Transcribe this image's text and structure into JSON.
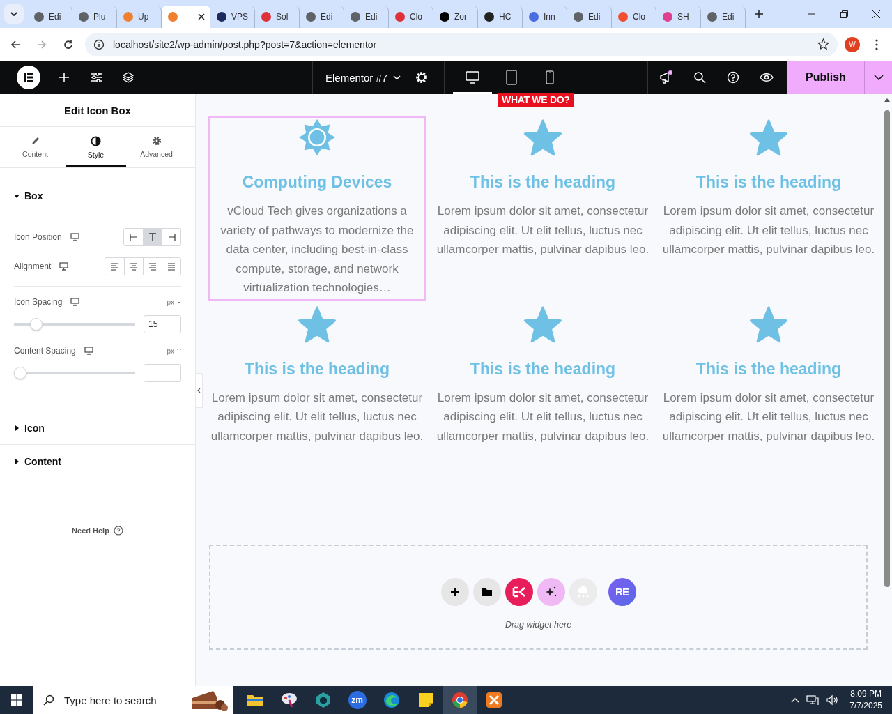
{
  "browser": {
    "tabs": [
      {
        "label": "Edi",
        "selected": false,
        "color": "#5f6368"
      },
      {
        "label": "Plu",
        "selected": false,
        "color": "#5f6368"
      },
      {
        "label": "Up",
        "selected": false,
        "color": "#f08030"
      },
      {
        "selected": true,
        "color": "#f08030"
      },
      {
        "label": "VPS",
        "selected": false,
        "color": "#1a2a5e"
      },
      {
        "label": "Sol",
        "selected": false,
        "color": "#e0303a"
      },
      {
        "label": "Edi",
        "selected": false,
        "color": "#5f6368"
      },
      {
        "label": "Edi",
        "selected": false,
        "color": "#5f6368"
      },
      {
        "label": "Clo",
        "selected": false,
        "color": "#e0303a"
      },
      {
        "label": "Zor",
        "selected": false,
        "color": "#000000"
      },
      {
        "label": "HC",
        "selected": false,
        "color": "#222222"
      },
      {
        "label": "Inn",
        "selected": false,
        "color": "#4a6ee0"
      },
      {
        "label": "Edi",
        "selected": false,
        "color": "#5f6368"
      },
      {
        "label": "Clo",
        "selected": false,
        "color": "#f05030"
      },
      {
        "label": "SH",
        "selected": false,
        "color": "#e04090"
      },
      {
        "label": "Edi",
        "selected": false,
        "color": "#5f6368"
      }
    ],
    "url": "localhost/site2/wp-admin/post.php?post=7&action=elementor",
    "profile": "W"
  },
  "editor_bar": {
    "document_title": "Elementor #7",
    "devices": [
      {
        "kind": "desktop",
        "selected": true
      },
      {
        "kind": "tablet",
        "selected": false
      },
      {
        "kind": "mobile",
        "selected": false
      }
    ],
    "publish": "Publish"
  },
  "panel": {
    "title": "Edit Icon Box",
    "tabs": [
      {
        "label": "Content",
        "kind": "pencil",
        "selected": false
      },
      {
        "label": "Style",
        "kind": "contrast",
        "selected": true
      },
      {
        "label": "Advanced",
        "kind": "gear",
        "selected": false
      }
    ],
    "sections": [
      {
        "label": "Box",
        "expanded": true,
        "controls": [
          {
            "kind": "choice",
            "label": "Icon Position",
            "options": [
              {
                "kind": "left",
                "selected": false
              },
              {
                "kind": "top",
                "selected": true
              },
              {
                "kind": "right",
                "selected": false
              }
            ]
          },
          {
            "kind": "choice",
            "label": "Alignment",
            "options": [
              {
                "kind": "align-left",
                "selected": false
              },
              {
                "kind": "align-center",
                "selected": false
              },
              {
                "kind": "align-right",
                "selected": false
              },
              {
                "kind": "justify",
                "selected": false
              }
            ]
          },
          {
            "kind": "slider",
            "label": "Icon Spacing",
            "unit": "px",
            "level": 0.15,
            "value": "15"
          },
          {
            "kind": "slider",
            "label": "Content Spacing",
            "unit": "px",
            "level": 0
          }
        ]
      },
      {
        "label": "Icon",
        "expanded": false
      },
      {
        "label": "Content",
        "expanded": false
      }
    ],
    "help": "Need Help"
  },
  "canvas": {
    "badge": "WHAT WE DO?",
    "boxes": [
      {
        "kind": "sun",
        "heading": "Computing Devices",
        "text": "vCloud Tech gives organizations a variety of pathways to modernize the data center, including best-in-class compute, storage, and network virtualization technologies…",
        "selected": true
      },
      {
        "kind": "star",
        "heading": "This is the heading",
        "text": "Lorem ipsum dolor sit amet, consectetur adipiscing elit. Ut elit tellus, luctus nec ullamcorper mattis, pulvinar dapibus leo.",
        "selected": false
      },
      {
        "kind": "star",
        "heading": "This is the heading",
        "text": "Lorem ipsum dolor sit amet, consectetur adipiscing elit. Ut elit tellus, luctus nec ullamcorper mattis, pulvinar dapibus leo.",
        "selected": false
      },
      {
        "kind": "star",
        "heading": "This is the heading",
        "text": "Lorem ipsum dolor sit amet, consectetur adipiscing elit. Ut elit tellus, luctus nec ullamcorper mattis, pulvinar dapibus leo.",
        "selected": false
      },
      {
        "kind": "star",
        "heading": "This is the heading",
        "text": "Lorem ipsum dolor sit amet, consectetur adipiscing elit. Ut elit tellus, luctus nec ullamcorper mattis, pulvinar dapibus leo.",
        "selected": false
      },
      {
        "kind": "star",
        "heading": "This is the heading",
        "text": "Lorem ipsum dolor sit amet, consectetur adipiscing elit. Ut elit tellus, luctus nec ullamcorper mattis, pulvinar dapibus leo.",
        "selected": false
      }
    ],
    "dropzone": {
      "buttons": [
        {
          "kind": "add"
        },
        {
          "kind": "folder"
        },
        {
          "kind": "ek"
        },
        {
          "kind": "ai"
        },
        {
          "kind": "cloud"
        },
        {
          "kind": "re",
          "label": "RE"
        }
      ],
      "hint": "Drag widget here"
    }
  },
  "taskbar": {
    "search_placeholder": "Type here to search",
    "apps": [
      {
        "kind": "explorer",
        "active": false
      },
      {
        "kind": "paint",
        "active": false
      },
      {
        "kind": "cube",
        "active": false
      },
      {
        "kind": "zoom",
        "label": "zm",
        "active": false
      },
      {
        "kind": "edge",
        "active": false
      },
      {
        "kind": "notes",
        "active": false
      },
      {
        "kind": "chrome",
        "active": true
      },
      {
        "kind": "xampp",
        "active": false
      }
    ],
    "time": "8:09 PM",
    "date": "7/7/2025"
  }
}
